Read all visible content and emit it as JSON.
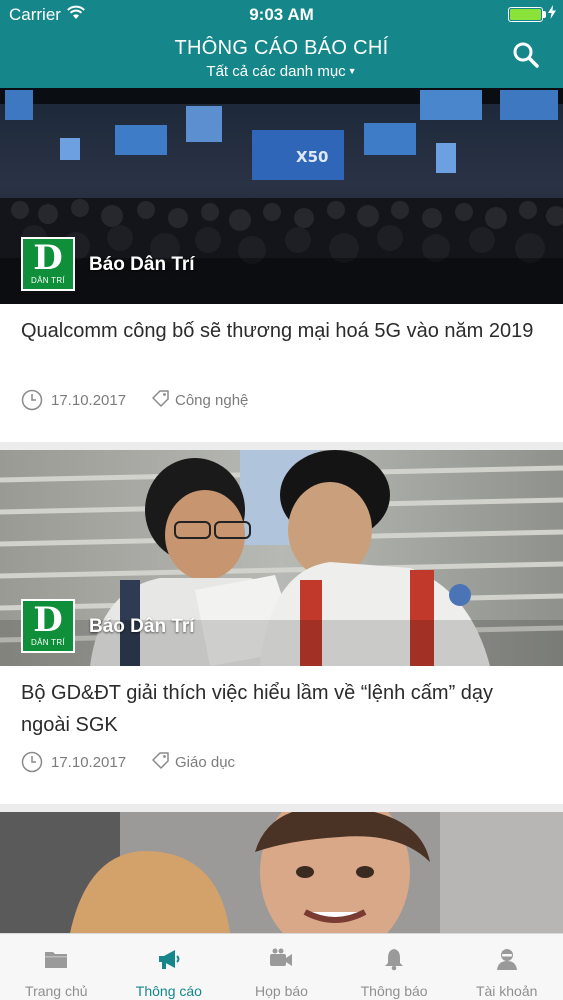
{
  "status_bar": {
    "carrier": "Carrier",
    "time": "9:03 AM",
    "battery_level": 1.0
  },
  "header": {
    "title": "THÔNG CÁO BÁO CHÍ",
    "subtitle": "Tất cả các danh mục",
    "accent_color": "#15878a",
    "search_icon": "search-icon"
  },
  "articles": [
    {
      "source_logo_big": "D",
      "source_logo_small": "DÂN TRÍ",
      "source": "Báo Dân Trí",
      "title": "Qualcomm công bố sẽ thương mại hoá 5G vào năm 2019",
      "date": "17.10.2017",
      "category": "Công nghệ",
      "image_screen_text": "X50"
    },
    {
      "source_logo_big": "D",
      "source_logo_small": "DÂN TRÍ",
      "source": "Báo Dân Trí",
      "title": "Bộ GD&ĐT giải thích việc hiểu lầm về “lệnh cấm” dạy ngoài SGK",
      "date": "17.10.2017",
      "category": "Giáo dục"
    }
  ],
  "tabs": [
    {
      "label": "Trang chủ",
      "icon": "folder-icon",
      "active": false
    },
    {
      "label": "Thông cáo",
      "icon": "megaphone-icon",
      "active": true
    },
    {
      "label": "Họp báo",
      "icon": "video-camera-icon",
      "active": false
    },
    {
      "label": "Thông báo",
      "icon": "bell-icon",
      "active": false
    },
    {
      "label": "Tài khoản",
      "icon": "user-icon",
      "active": false
    }
  ]
}
